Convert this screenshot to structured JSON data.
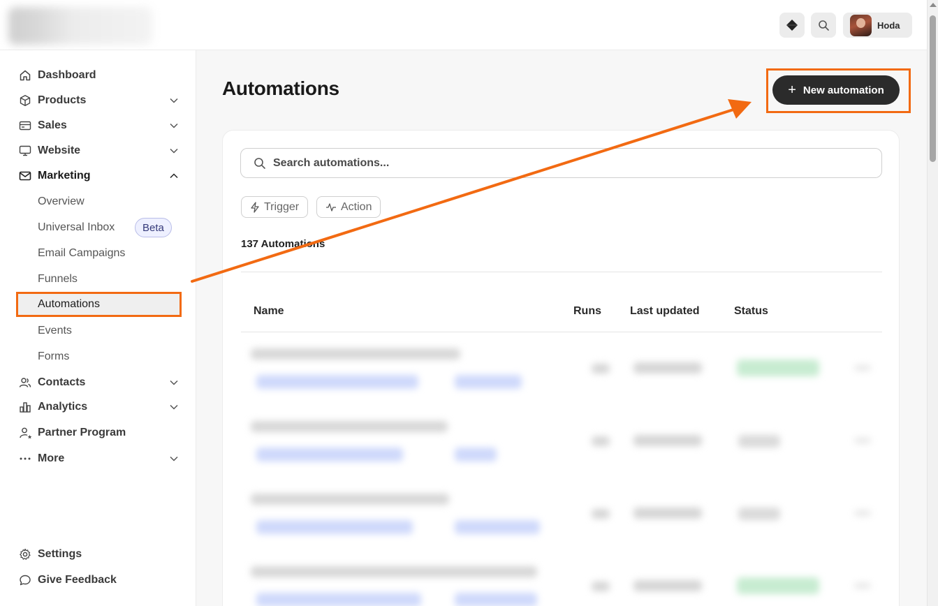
{
  "topbar": {
    "user_name": "Hoda"
  },
  "sidebar": {
    "nav": [
      {
        "label": "Dashboard",
        "icon": "home-icon",
        "chevron": ""
      },
      {
        "label": "Products",
        "icon": "box-icon",
        "chevron": "down"
      },
      {
        "label": "Sales",
        "icon": "credit-card-icon",
        "chevron": "down"
      },
      {
        "label": "Website",
        "icon": "monitor-icon",
        "chevron": "down"
      },
      {
        "label": "Marketing",
        "icon": "mail-icon",
        "chevron": "up"
      }
    ],
    "marketing_sub": [
      {
        "label": "Overview"
      },
      {
        "label": "Universal Inbox",
        "badge": "Beta"
      },
      {
        "label": "Email Campaigns"
      },
      {
        "label": "Funnels"
      },
      {
        "label": "Automations",
        "active": true
      },
      {
        "label": "Events"
      },
      {
        "label": "Forms"
      }
    ],
    "nav_lower": [
      {
        "label": "Contacts",
        "icon": "users-icon",
        "chevron": "down"
      },
      {
        "label": "Analytics",
        "icon": "bar-chart-icon",
        "chevron": "down"
      },
      {
        "label": "Partner Program",
        "icon": "user-star-icon",
        "chevron": ""
      },
      {
        "label": "More",
        "icon": "ellipsis-icon",
        "chevron": "down"
      }
    ],
    "footer": [
      {
        "label": "Settings",
        "icon": "gear-icon"
      },
      {
        "label": "Give Feedback",
        "icon": "chat-bubble-icon"
      }
    ]
  },
  "main": {
    "title": "Automations",
    "new_button": "New automation",
    "search_placeholder": "Search automations...",
    "filters": [
      "Trigger",
      "Action"
    ],
    "count_label": "137 Automations",
    "columns": {
      "name": "Name",
      "runs": "Runs",
      "last_updated": "Last updated",
      "status": "Status"
    }
  },
  "colors": {
    "accent": "#f26a12",
    "primary_button": "#2b2b2b",
    "beta_badge": "#eef0ff"
  }
}
